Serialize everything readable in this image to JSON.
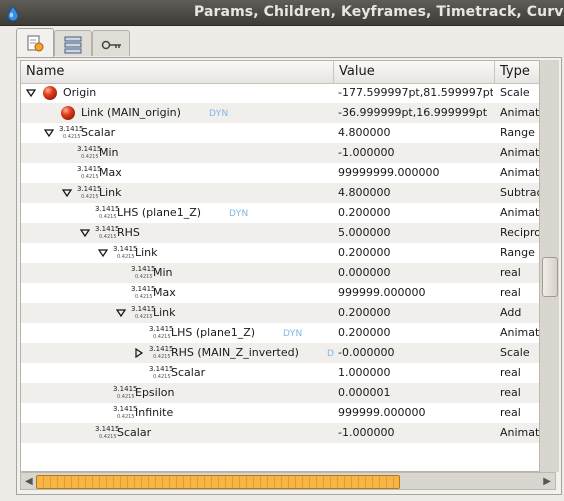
{
  "window": {
    "title": "Params, Children, Keyframes, Timetrack, Curves"
  },
  "tabs": [
    {
      "icon": "params-panel-icon",
      "active": true
    },
    {
      "icon": "children-panel-icon",
      "active": false
    },
    {
      "icon": "keyframes-panel-icon",
      "active": false
    }
  ],
  "columns": {
    "name": "Name",
    "value": "Value",
    "type": "Type"
  },
  "real_icon": {
    "top": "3.1415",
    "bottom": "0.4215"
  },
  "dyn_badge": "DYN",
  "rows": [
    {
      "indent": 0,
      "expander": "open",
      "icon": "ball",
      "name": "Origin",
      "dyn": false,
      "value": "-177.599997pt,81.599997pt",
      "type": "Scale"
    },
    {
      "indent": 1,
      "expander": "none",
      "icon": "ball",
      "name": "Link (MAIN_origin)",
      "dyn": true,
      "value": "-36.999999pt,16.999999pt",
      "type": "Animated"
    },
    {
      "indent": 1,
      "expander": "open",
      "icon": "real",
      "name": "Scalar",
      "dyn": false,
      "value": "4.800000",
      "type": "Range"
    },
    {
      "indent": 2,
      "expander": "none",
      "icon": "real",
      "name": "Min",
      "dyn": false,
      "value": "-1.000000",
      "type": "Animated"
    },
    {
      "indent": 2,
      "expander": "none",
      "icon": "real",
      "name": "Max",
      "dyn": false,
      "value": "99999999.000000",
      "type": "Animated"
    },
    {
      "indent": 2,
      "expander": "open",
      "icon": "real",
      "name": "Link",
      "dyn": false,
      "value": "4.800000",
      "type": "Subtract"
    },
    {
      "indent": 3,
      "expander": "none",
      "icon": "real",
      "name": "LHS (plane1_Z)",
      "dyn": true,
      "value": "0.200000",
      "type": "Animated"
    },
    {
      "indent": 3,
      "expander": "open",
      "icon": "real",
      "name": "RHS",
      "dyn": false,
      "value": "5.000000",
      "type": "Reciproca"
    },
    {
      "indent": 4,
      "expander": "open",
      "icon": "real",
      "name": "Link",
      "dyn": false,
      "value": "0.200000",
      "type": "Range"
    },
    {
      "indent": 5,
      "expander": "none",
      "icon": "real",
      "name": "Min",
      "dyn": false,
      "value": "0.000000",
      "type": "real"
    },
    {
      "indent": 5,
      "expander": "none",
      "icon": "real",
      "name": "Max",
      "dyn": false,
      "value": "999999.000000",
      "type": "real"
    },
    {
      "indent": 5,
      "expander": "open",
      "icon": "real",
      "name": "Link",
      "dyn": false,
      "value": "0.200000",
      "type": "Add"
    },
    {
      "indent": 6,
      "expander": "none",
      "icon": "real",
      "name": "LHS (plane1_Z)",
      "dyn": true,
      "value": "0.200000",
      "type": "Animated"
    },
    {
      "indent": 6,
      "expander": "closed",
      "icon": "real",
      "name": "RHS (MAIN_Z_inverted)",
      "dyn": true,
      "value": "-0.000000",
      "type": "Scale"
    },
    {
      "indent": 6,
      "expander": "none",
      "icon": "real",
      "name": "Scalar",
      "dyn": false,
      "value": "1.000000",
      "type": "real"
    },
    {
      "indent": 4,
      "expander": "none",
      "icon": "real",
      "name": "Epsilon",
      "dyn": false,
      "value": "0.000001",
      "type": "real"
    },
    {
      "indent": 4,
      "expander": "none",
      "icon": "real",
      "name": "Infinite",
      "dyn": false,
      "value": "999999.000000",
      "type": "real"
    },
    {
      "indent": 3,
      "expander": "none",
      "icon": "real",
      "name": "Scalar",
      "dyn": false,
      "value": "-1.000000",
      "type": "Animated"
    }
  ],
  "colors": {
    "accent": "#f6b547",
    "titlebar": "#3c3b37",
    "dyn": "#7fb8e6",
    "row_alt": "#f1efec"
  }
}
